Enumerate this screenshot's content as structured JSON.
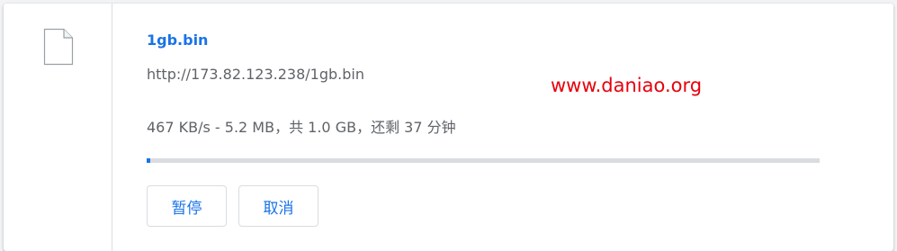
{
  "download": {
    "file_name": "1gb.bin",
    "url": "http://173.82.123.238/1gb.bin",
    "status": "467 KB/s - 5.2 MB，共 1.0 GB，还剩 37 分钟",
    "progress_fraction": 0.005,
    "icon": "file-icon"
  },
  "actions": {
    "pause_label": "暂停",
    "cancel_label": "取消"
  },
  "watermark": {
    "text": "www.daniao.org",
    "color": "#e8000b"
  },
  "colors": {
    "accent": "#1a73e8",
    "secondary_text": "#5f6368",
    "track": "#dadce0"
  }
}
